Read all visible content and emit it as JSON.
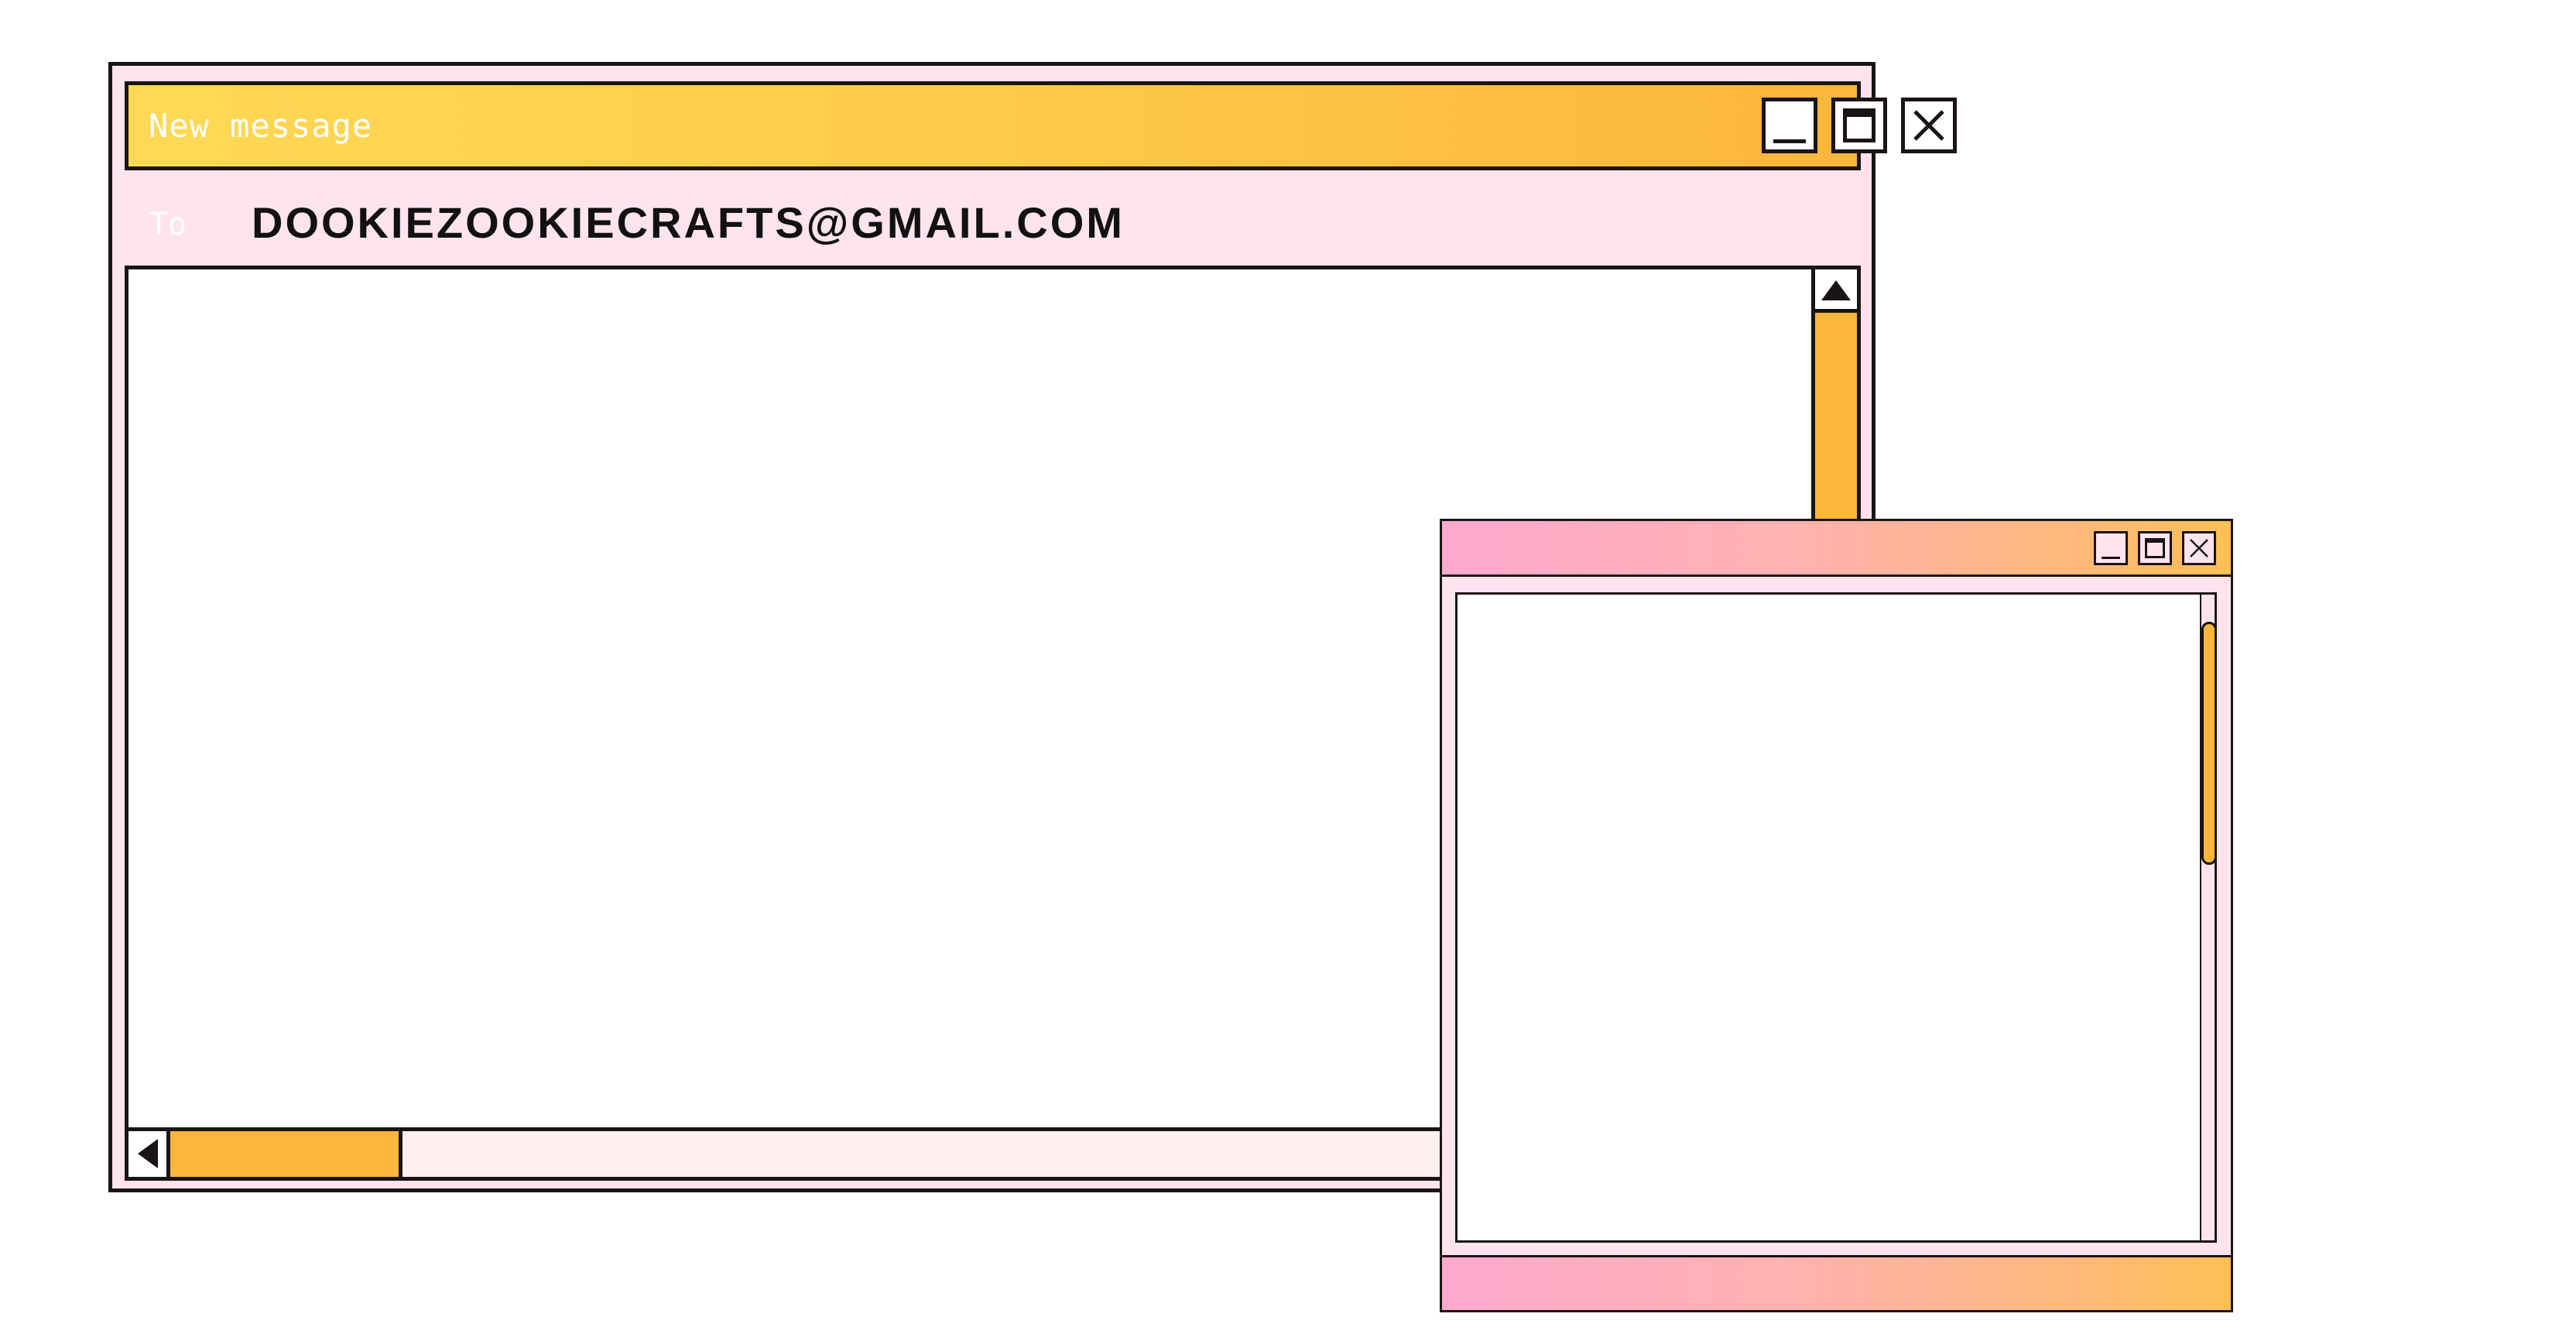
{
  "main_window": {
    "title": "New message",
    "to_label": "To",
    "to_value": "DOOKIEZOOKIECRAFTS@GMAIL.COM",
    "controls": [
      "minimize-icon",
      "maximize-icon",
      "close-icon"
    ]
  },
  "popup_window": {
    "controls": [
      "minimize-icon",
      "maximize-icon",
      "close-icon"
    ]
  },
  "colors": {
    "title_gradient_start": "#ffd955",
    "title_gradient_end": "#fbb63b",
    "accent_orange": "#fbb63b",
    "window_pink": "#ffe4f0",
    "popup_gradient_start": "#ffa9cf",
    "popup_gradient_end": "#ffc055",
    "outline": "#1a1414"
  }
}
